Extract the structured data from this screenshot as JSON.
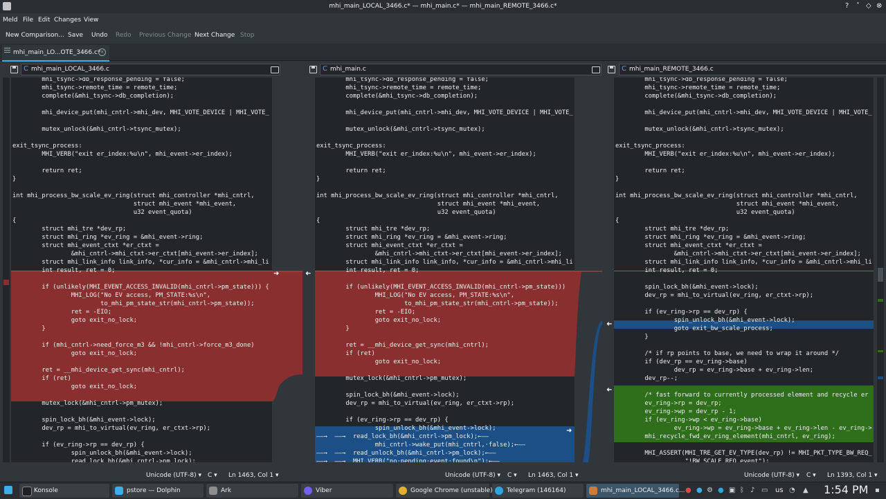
{
  "window": {
    "title": "mhi_main_LOCAL_3466.c* — mhi_main.c* — mhi_main_REMOTE_3466.c*",
    "controls": [
      "?",
      "˅",
      "◇",
      "⊗"
    ]
  },
  "menu": [
    "Meld",
    "File",
    "Edit",
    "Changes",
    "View"
  ],
  "toolbar": {
    "new_comparison": "New Comparison...",
    "save": "Save",
    "undo": "Undo",
    "redo": "Redo",
    "prev_change": "Previous Change",
    "next_change": "Next Change",
    "stop": "Stop"
  },
  "tab": {
    "label": "mhi_main_LO...OTE_3466.c*",
    "close": "×"
  },
  "panes": {
    "left": {
      "file": "mhi_main_LOCAL_3466.c",
      "encoding": "Unicode (UTF-8) ▾",
      "lang": "C ▾",
      "position": "Ln 1463, Col 1 ▾"
    },
    "middle": {
      "file": "mhi_main.c",
      "encoding": "Unicode (UTF-8) ▾",
      "lang": "C ▾",
      "position": "Ln 1463, Col 1 ▾"
    },
    "right": {
      "file": "mhi_main_REMOTE_3466.c",
      "encoding": "Unicode (UTF-8) ▾",
      "lang": "C ▾",
      "position": "Ln 1393, Col 1 ▾"
    }
  },
  "code": {
    "left": "        mhi_tsync->db_response_pending = false;\n        mhi_tsync->remote_time = remote_time;\n        complete(&mhi_tsync->db_completion);\n\n        mhi_device_put(mhi_cntrl->mhi_dev, MHI_VOTE_DEVICE | MHI_VOTE_\n\n        mutex_unlock(&mhi_cntrl->tsync_mutex);\n\nexit_tsync_process:\n        MHI_VERB(\"exit er_index:%u\\n\", mhi_event->er_index);\n\n        return ret;\n}\n\nint mhi_process_bw_scale_ev_ring(struct mhi_controller *mhi_cntrl,\n                                 struct mhi_event *mhi_event,\n                                 u32 event_quota)\n{\n        struct mhi_tre *dev_rp;\n        struct mhi_ring *ev_ring = &mhi_event->ring;\n        struct mhi_event_ctxt *er_ctxt =\n                &mhi_cntrl->mhi_ctxt->er_ctxt[mhi_event->er_index];\n        struct mhi_link_info link_info, *cur_info = &mhi_cntrl->mhi_li\n        int result, ret = 0;\n\n        if (unlikely(MHI_EVENT_ACCESS_INVALID(mhi_cntrl->pm_state))) {\n                MHI_LOG(\"No EV access, PM_STATE:%s\\n\",\n                        to_mhi_pm_state_str(mhi_cntrl->pm_state));\n                ret = -EIO;\n                goto exit_no_lock;\n        }\n\n        if (mhi_cntrl->need_force_m3 && !mhi_cntrl->force_m3_done)\n                goto exit_no_lock;\n\n        ret = __mhi_device_get_sync(mhi_cntrl);\n        if (ret)\n                goto exit_no_lock;\n\n        mutex_lock(&mhi_cntrl->pm_mutex);\n\n        spin_lock_bh(&mhi_event->lock);\n        dev_rp = mhi_to_virtual(ev_ring, er_ctxt->rp);\n\n        if (ev_ring->rp == dev_rp) {\n                spin_unlock_bh(&mhi_event->lock);\n                read_lock_bh(&mhi_cntrl->pm_lock);\n                mhi_cntrl->wake_put(mhi_cntrl, false);",
    "middle": "        mhi_tsync->db_response_pending = false;\n        mhi_tsync->remote_time = remote_time;\n        complete(&mhi_tsync->db_completion);\n\n        mhi_device_put(mhi_cntrl->mhi_dev, MHI_VOTE_DEVICE | MHI_VOTE_\n\n        mutex_unlock(&mhi_cntrl->tsync_mutex);\n\nexit_tsync_process:\n        MHI_VERB(\"exit er_index:%u\\n\", mhi_event->er_index);\n\n        return ret;\n}\n\nint mhi_process_bw_scale_ev_ring(struct mhi_controller *mhi_cntrl,\n                                 struct mhi_event *mhi_event,\n                                 u32 event_quota)\n{\n        struct mhi_tre *dev_rp;\n        struct mhi_ring *ev_ring = &mhi_event->ring;\n        struct mhi_event_ctxt *er_ctxt =\n                &mhi_cntrl->mhi_ctxt->er_ctxt[mhi_event->er_index];\n        struct mhi_link_info link_info, *cur_info = &mhi_cntrl->mhi_li\n        int result, ret = 0;\n\n        if (unlikely(MHI_EVENT_ACCESS_INVALID(mhi_cntrl->pm_state)))\n                MHI_LOG(\"No EV access, PM_STATE:%s\\n\",\n                        to_mhi_pm_state_str(mhi_cntrl->pm_state));\n                ret = -EIO;\n                goto exit_no_lock;\n        }\n\n        ret = __mhi_device_get_sync(mhi_cntrl);\n        if (ret)\n                goto exit_no_lock;\n\n        mutex_lock(&mhi_cntrl->pm_mutex);\n\n        spin_lock_bh(&mhi_event->lock);\n        dev_rp = mhi_to_virtual(ev_ring, er_ctxt->rp);\n\n        if (ev_ring->rp == dev_rp) {\n                spin_unlock_bh(&mhi_event->lock);\n——→  ——→  read_lock_bh(&mhi_cntrl->pm_lock);←——\n                mhi_cntrl->wake_put(mhi_cntrl,·false);←——\n——→  ——→  read_unlock_bh(&mhi_cntrl->pm_lock);←——\n——→  ——→  MHI_VERB(\"no·pending·event·found\\n\");←——\n                goto exit_bw_process;",
    "right": "        mhi_tsync->db_response_pending = false;\n        mhi_tsync->remote_time = remote_time;\n        complete(&mhi_tsync->db_completion);\n\n        mhi_device_put(mhi_cntrl->mhi_dev, MHI_VOTE_DEVICE | MHI_VOTE_\n\n        mutex_unlock(&mhi_cntrl->tsync_mutex);\n\nexit_tsync_process:\n        MHI_VERB(\"exit er_index:%u\\n\", mhi_event->er_index);\n\n        return ret;\n}\n\nint mhi_process_bw_scale_ev_ring(struct mhi_controller *mhi_cntrl,\n                                 struct mhi_event *mhi_event,\n                                 u32 event_quota)\n{\n        struct mhi_tre *dev_rp;\n        struct mhi_ring *ev_ring = &mhi_event->ring;\n        struct mhi_event_ctxt *er_ctxt =\n                &mhi_cntrl->mhi_ctxt->er_ctxt[mhi_event->er_index];\n        struct mhi_link_info link_info, *cur_info = &mhi_cntrl->mhi_li\n        int result, ret = 0;\n\n        spin_lock_bh(&mhi_event->lock);\n        dev_rp = mhi_to_virtual(ev_ring, er_ctxt->rp);\n\n        if (ev_ring->rp == dev_rp) {\n                spin_unlock_bh(&mhi_event->lock);\n                goto exit_bw_scale_process;\n        }\n\n        /* if rp points to base, we need to wrap it around */\n        if (dev_rp == ev_ring->base)\n                dev_rp = ev_ring->base + ev_ring->len;\n        dev_rp--;\n\n        /* fast forward to currently processed element and recycle er\n        ev_ring->rp = dev_rp;\n        ev_ring->wp = dev_rp - 1;\n        if (ev_ring->wp < ev_ring->base)\n                ev_ring->wp = ev_ring->base + ev_ring->len - ev_ring->\n        mhi_recycle_fwd_ev_ring_element(mhi_cntrl, ev_ring);\n\n        MHI_ASSERT(MHI_TRE_GET_EV_TYPE(dev_rp) != MHI_PKT_TYPE_BW_REQ_\n                   \"!BW SCALE REQ event\");"
  },
  "colors": {
    "conflict_red": "#8a2f2f",
    "insert_green": "#2f6e1a",
    "change_blue": "#1b4f86",
    "editor_bg": "#232629",
    "window_bg": "#31363b",
    "accent": "#3daee9"
  },
  "taskbar": {
    "items": [
      {
        "label": "Konsole",
        "icon": "terminal-icon"
      },
      {
        "label": "pstore — Dolphin",
        "icon": "folder-icon"
      },
      {
        "label": "Ark",
        "icon": "archive-icon"
      },
      {
        "label": "Viber",
        "icon": "viber-icon"
      },
      {
        "label": "Google Chrome (unstable)",
        "icon": "chrome-icon"
      },
      {
        "label": "Telegram (146164)",
        "icon": "telegram-icon"
      },
      {
        "label": "mhi_main_LOCAL_3466.c...",
        "icon": "meld-icon"
      }
    ],
    "keyboard": "us",
    "clock": "1:54 PM"
  }
}
